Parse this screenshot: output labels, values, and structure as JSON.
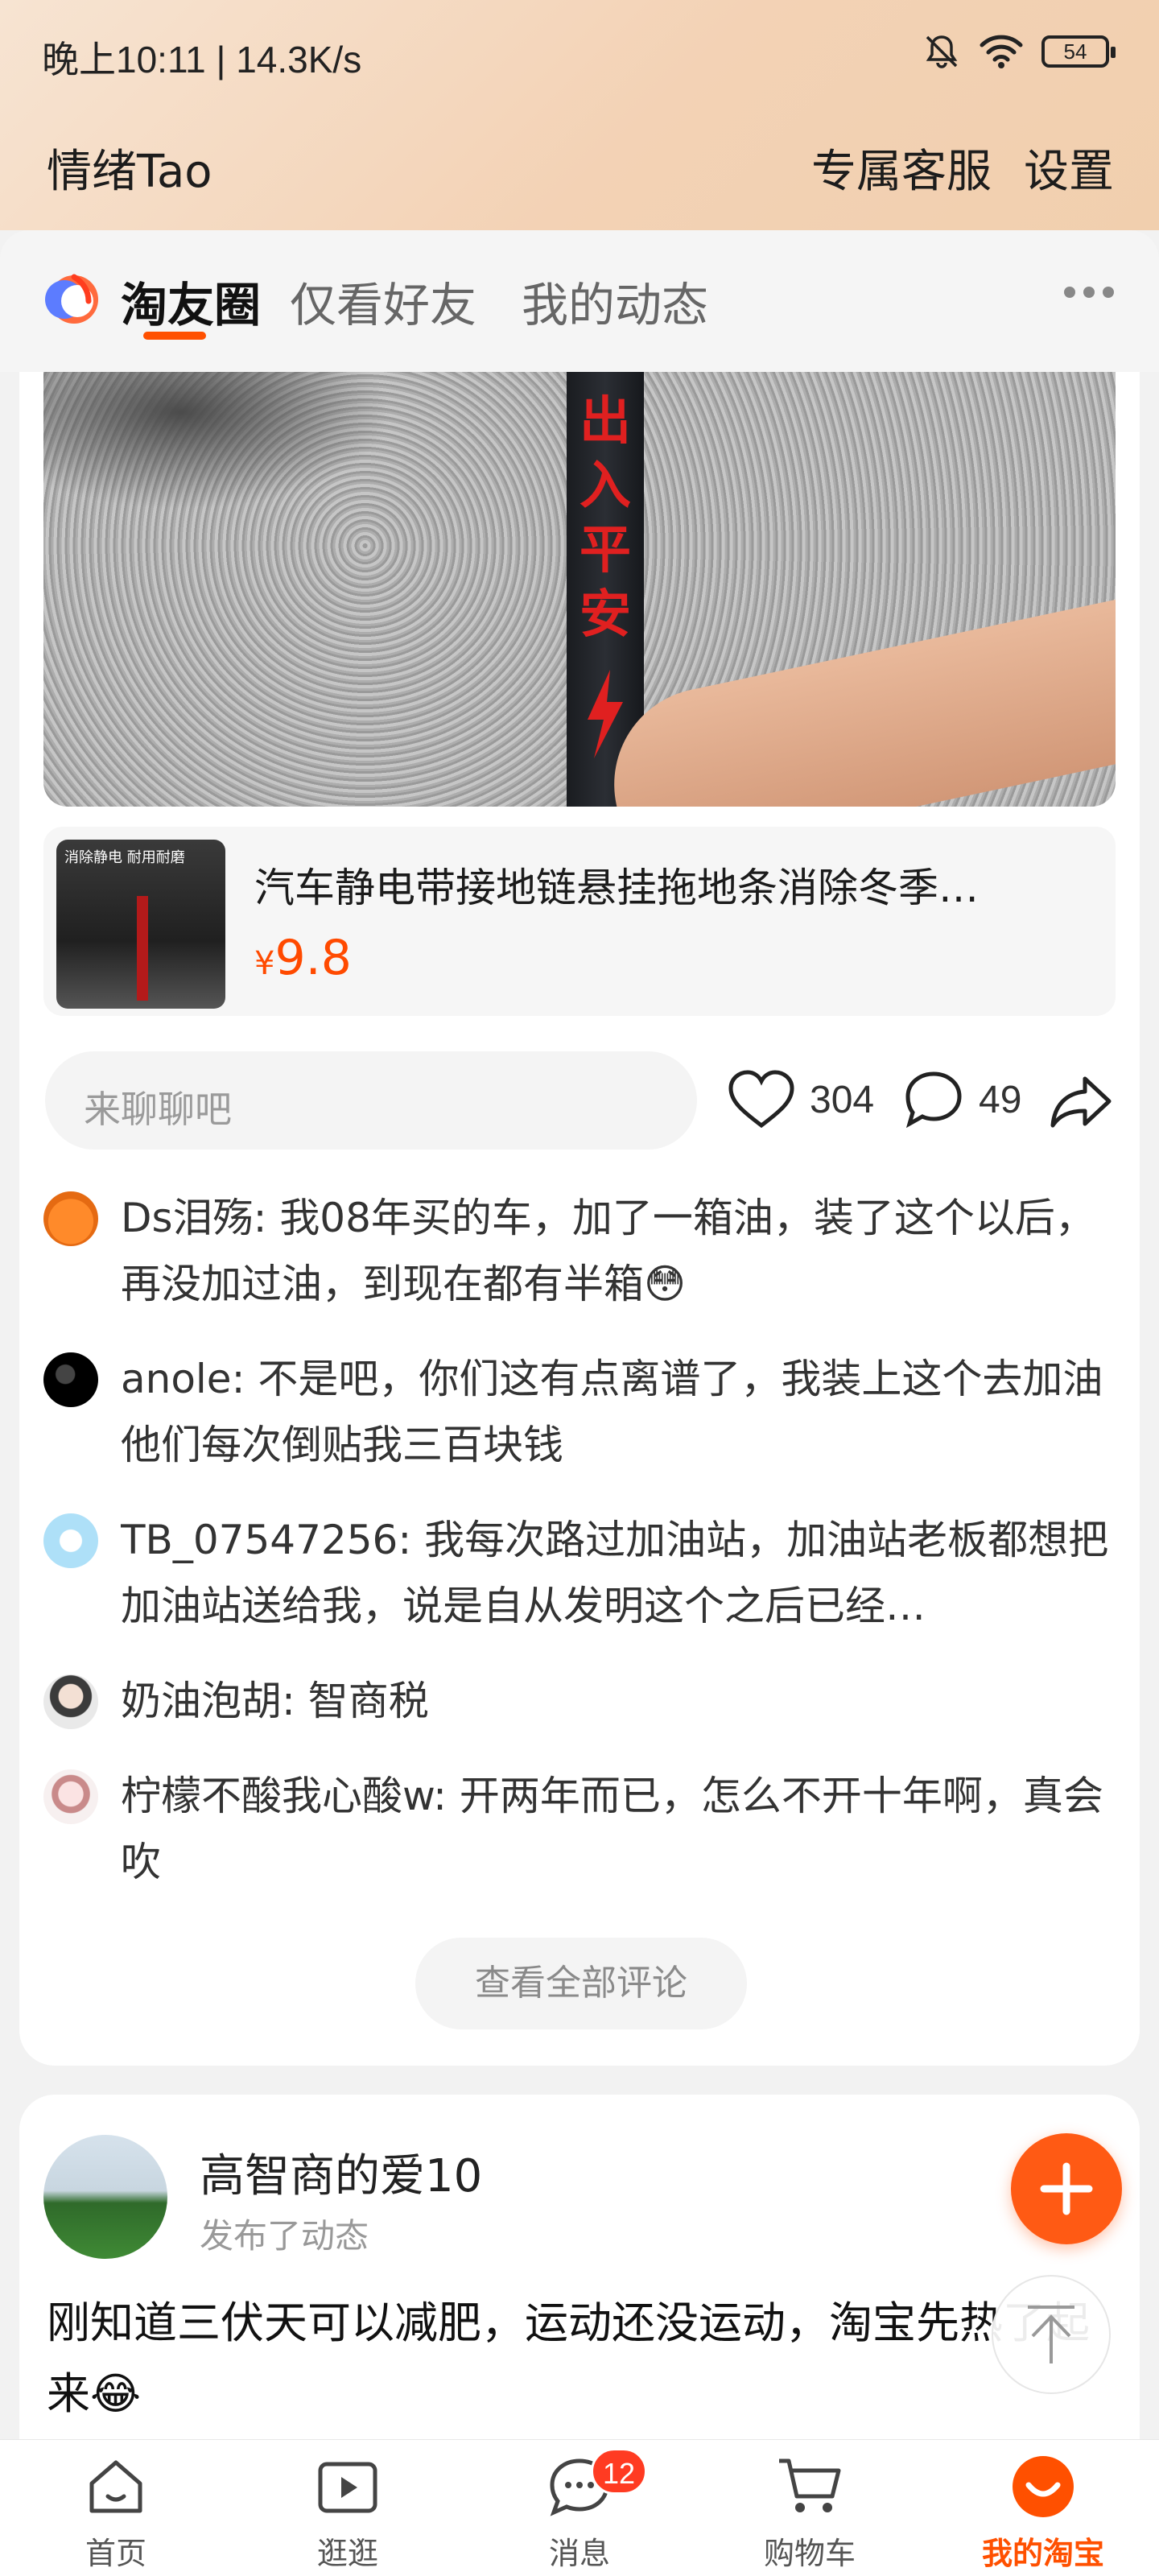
{
  "status_bar": {
    "time": "晚上10:11 | 14.3K/s",
    "battery": "54",
    "icons": [
      "bell-muted-icon",
      "wifi-icon",
      "battery-icon"
    ]
  },
  "header": {
    "title": "情绪Tao",
    "links": [
      "专属客服",
      "设置"
    ]
  },
  "tabs": {
    "items": [
      "淘友圈",
      "仅看好友",
      "我的动态"
    ],
    "active_index": 0
  },
  "post1": {
    "video_overlay_text": "出入平安",
    "product": {
      "thumb_caption": "消除静电 耐用耐磨",
      "title": "汽车静电带接地链悬挂拖地条消除冬季…",
      "currency": "¥",
      "price": "9.8"
    },
    "chat_placeholder": "来聊聊吧",
    "likes": "304",
    "comments_count": "49",
    "comments": [
      {
        "user": "Ds泪殇",
        "text": "我08年买的车，加了一箱油，装了这个以后，再没加过油，到现在都有半箱😳"
      },
      {
        "user": "anole",
        "text": "不是吧，你们这有点离谱了，我装上这个去加油他们每次倒贴我三百块钱"
      },
      {
        "user": "TB_07547256",
        "text": "我每次路过加油站，加油站老板都想把加油站送给我，说是自从发明这个之后已经…"
      },
      {
        "user": "奶油泡胡",
        "text": "智商税"
      },
      {
        "user": "柠檬不酸我心酸w",
        "text": "开两年而已，怎么不开十年啊，真会吹"
      }
    ],
    "view_all_label": "查看全部评论"
  },
  "post2": {
    "author": "高智商的爱10",
    "subtitle": "发布了动态",
    "text": "刚知道三伏天可以减肥，运动还没运动，淘宝先热了起来😂"
  },
  "bottom_nav": {
    "items": [
      {
        "label": "首页",
        "icon": "home-icon"
      },
      {
        "label": "逛逛",
        "icon": "play-icon"
      },
      {
        "label": "消息",
        "icon": "message-icon",
        "badge": "12"
      },
      {
        "label": "购物车",
        "icon": "cart-icon"
      },
      {
        "label": "我的淘宝",
        "icon": "taobao-smile-icon"
      }
    ],
    "active_index": 4
  },
  "colors": {
    "accent": "#ff5000",
    "price": "#ff4a00",
    "badge": "#ff3b22"
  }
}
